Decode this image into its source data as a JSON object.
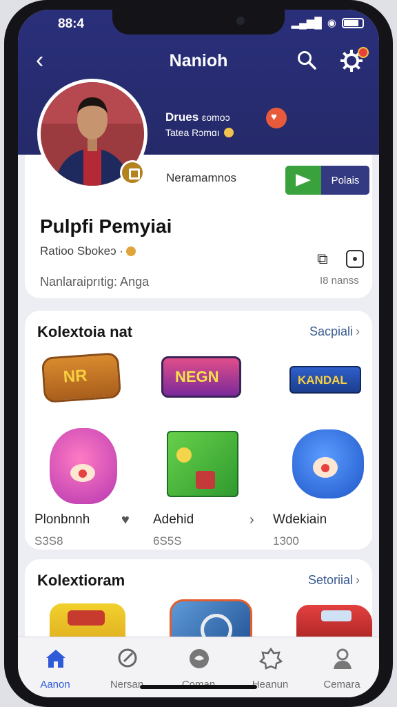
{
  "status": {
    "time": "88:4"
  },
  "header": {
    "title": "Nanioh"
  },
  "profile": {
    "group_name": "Drues",
    "group_name_suffix": "ɛomoɔ",
    "group_sub": "Tatea Rɔmɑı",
    "rank_label": "Neramamnos",
    "follow_label": "Polais",
    "name": "Pulpfi Pemyiai",
    "sub": "Ratioo Sbokeɔ ·",
    "meta": "Nanlaraiprıtig: Anga",
    "meta_count": "I8 nanss"
  },
  "collections": [
    {
      "title": "Kolextoia nat",
      "see_all": "Sacpiali",
      "badges": [
        "NR",
        "NEGN",
        "KANDAL"
      ],
      "items": [
        {
          "name": "Plonbnnh",
          "price": "S3S8"
        },
        {
          "name": "Adehid",
          "price": "6S5S"
        },
        {
          "name": "Wdekiain",
          "price": "1300"
        }
      ]
    },
    {
      "title": "Kolextioram",
      "see_all": "Setoriial"
    }
  ],
  "tabs": [
    {
      "label": "Aanon"
    },
    {
      "label": "Nersan"
    },
    {
      "label": "Coman"
    },
    {
      "label": "Heanun"
    },
    {
      "label": "Cemara"
    }
  ],
  "colors": {
    "header_bg": "#2a2f7a",
    "accent": "#2f5ad8",
    "follow_green": "#39a23c",
    "follow_navy": "#343a82"
  },
  "icons": [
    "back-icon",
    "search-icon",
    "gear-icon",
    "share-icon",
    "expand-icon",
    "home-icon",
    "search-tab-icon",
    "chat-icon",
    "puzzle-icon",
    "person-icon"
  ]
}
